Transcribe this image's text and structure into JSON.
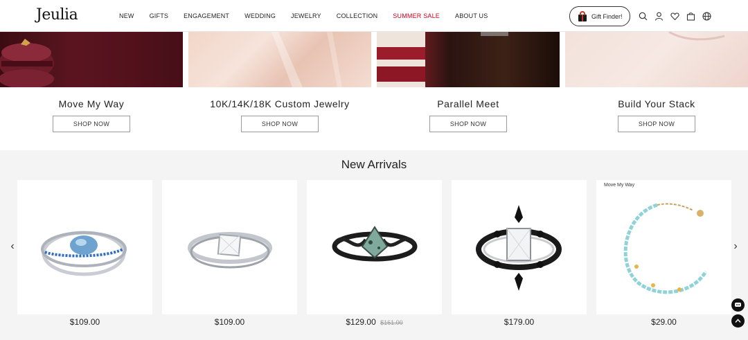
{
  "brand": {
    "logo_text": "Jeulia"
  },
  "nav": {
    "items": [
      "NEW",
      "GIFTS",
      "ENGAGEMENT",
      "WEDDING",
      "JEWELRY",
      "COLLECTION",
      "SUMMER SALE",
      "ABOUT US"
    ]
  },
  "header": {
    "gift_finder_label": "Gift Finder!",
    "icons": [
      "search-icon",
      "user-icon",
      "heart-icon",
      "bag-icon",
      "globe-icon"
    ]
  },
  "tiles": [
    {
      "title": "Move My Way",
      "button": "SHOP NOW"
    },
    {
      "title": "10K/14K/18K Custom Jewelry",
      "button": "SHOP NOW"
    },
    {
      "title": "Parallel Meet",
      "button": "SHOP NOW"
    },
    {
      "title": "Build Your Stack",
      "button": "SHOP NOW"
    }
  ],
  "arrivals": {
    "title": "New Arrivals",
    "products": [
      {
        "name": "blue-stone-ring",
        "price": "$109.00",
        "old_price": "",
        "tag": ""
      },
      {
        "name": "silver-princess-ring",
        "price": "$109.00",
        "old_price": "",
        "tag": ""
      },
      {
        "name": "moss-agate-black-ring",
        "price": "$129.00",
        "old_price": "$161.00",
        "tag": ""
      },
      {
        "name": "black-white-radiant-ring",
        "price": "$179.00",
        "old_price": "",
        "tag": ""
      },
      {
        "name": "turquoise-cord-bracelet",
        "price": "$29.00",
        "old_price": "",
        "tag": "Move My Way"
      }
    ]
  },
  "colors": {
    "sale": "#d0021b",
    "section_bg": "#f4f4f4"
  }
}
